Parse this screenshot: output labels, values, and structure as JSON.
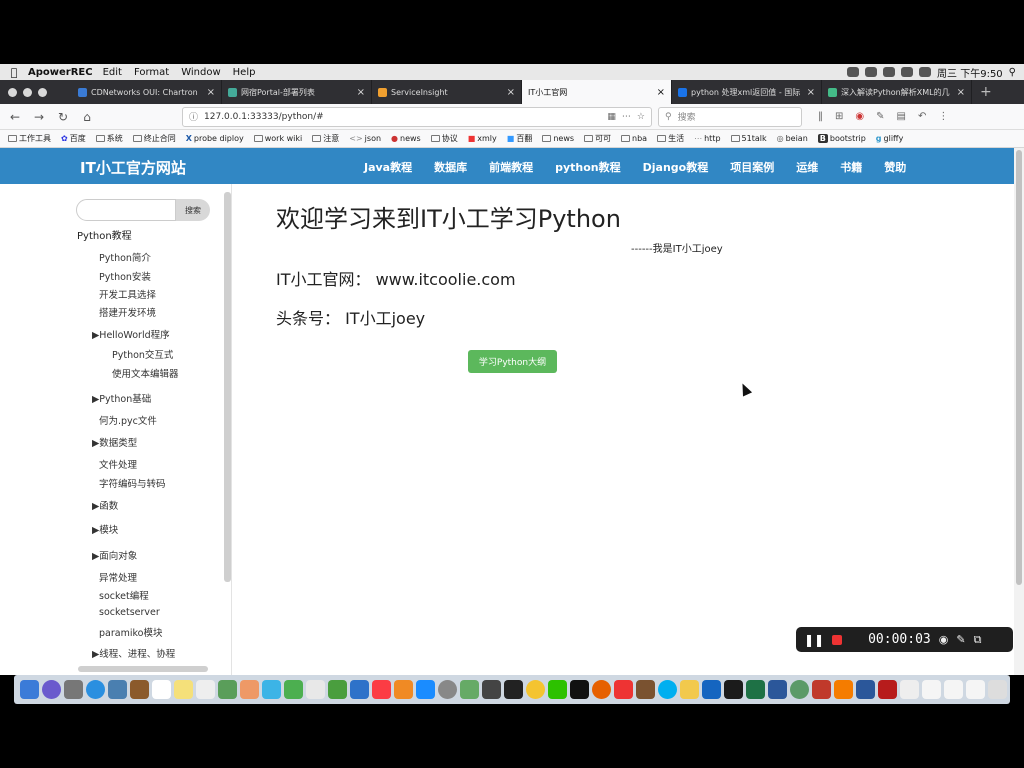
{
  "menubar": {
    "app_name": "ApowerREC",
    "menus": [
      "Edit",
      "Format",
      "Window",
      "Help"
    ],
    "clock": "周三 下午9:50"
  },
  "tabs": [
    {
      "label": "CDNetworks OUI: Chartron",
      "color": "#3a7bd5"
    },
    {
      "label": "网宿Portal-部署列表",
      "color": "#4a9"
    },
    {
      "label": "ServiceInsight",
      "color": "#f0a030"
    },
    {
      "label": "IT小工官网",
      "color": "#3187c4"
    },
    {
      "label": "python 处理xml返回值 - 国际",
      "color": "#1a73e8"
    },
    {
      "label": "深入解读Python解析XML的几",
      "color": "#4b8"
    }
  ],
  "navbar": {
    "url": "127.0.0.1:33333/python/#",
    "search_placeholder": "搜索"
  },
  "bookmarks": [
    "工作工具",
    "百度",
    "系统",
    "终止合同",
    "probe diploy",
    "work wiki",
    "注意",
    "json",
    "news",
    "协议",
    "xmly",
    "百翻",
    "news",
    "可可",
    "nba",
    "生活",
    "http",
    "51talk",
    "beian",
    "bootstrip",
    "gliffy"
  ],
  "site": {
    "logo": "IT小工官方网站",
    "nav": [
      "Java教程",
      "数据库",
      "前端教程",
      "python教程",
      "Django教程",
      "项目案例",
      "运维",
      "书籍",
      "赞助"
    ]
  },
  "sidebar": {
    "search_button": "搜索",
    "title": "Python教程",
    "items": [
      {
        "label": "Python简介"
      },
      {
        "label": "Python安装"
      },
      {
        "label": "开发工具选择"
      },
      {
        "label": "搭建开发环境"
      },
      {
        "label": "▶HelloWorld程序"
      },
      {
        "label": "Python交互式"
      },
      {
        "label": "使用文本编辑器"
      },
      {
        "label": "▶Python基础"
      },
      {
        "label": "何为.pyc文件"
      },
      {
        "label": "▶数据类型"
      },
      {
        "label": "文件处理"
      },
      {
        "label": "字符编码与转码"
      },
      {
        "label": "▶函数"
      },
      {
        "label": "▶模块"
      },
      {
        "label": "▶面向对象"
      },
      {
        "label": "异常处理"
      },
      {
        "label": "socket编程"
      },
      {
        "label": "socketserver"
      },
      {
        "label": "paramiko模块"
      },
      {
        "label": "▶线程、进程、协程"
      }
    ]
  },
  "main": {
    "title": "欢迎学习来到IT小工学习Python",
    "author": "------我是IT小工joey",
    "site_line": "IT小工官网：  www.itcoolie.com",
    "toutiao_line": "头条号：  IT小工joey",
    "button": "学习Python大纲"
  },
  "recorder": {
    "time": "00:00:03"
  }
}
